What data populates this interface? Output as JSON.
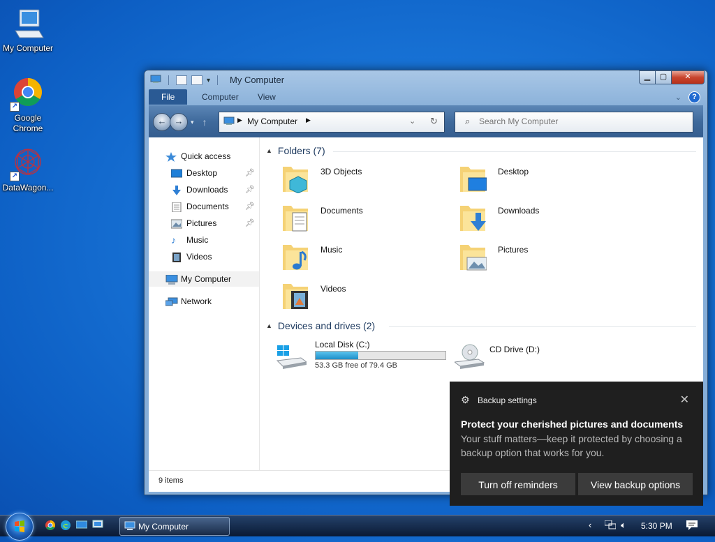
{
  "desktop": {
    "icons": [
      {
        "label": "My Computer"
      },
      {
        "label": "Google\nChrome"
      },
      {
        "label": "DataWagon..."
      }
    ]
  },
  "window": {
    "title": "My Computer",
    "controls": {
      "close": "✕"
    },
    "ribbon": {
      "tabs": [
        "File",
        "Computer",
        "View"
      ],
      "help": "?"
    },
    "address": {
      "path": "My Computer"
    },
    "search": {
      "placeholder": "Search My Computer"
    },
    "nav": [
      {
        "label": "Quick access",
        "icon": "star-icon"
      },
      {
        "label": "Desktop",
        "icon": "desktop-icon",
        "pinned": true
      },
      {
        "label": "Downloads",
        "icon": "download-icon",
        "pinned": true
      },
      {
        "label": "Documents",
        "icon": "document-icon",
        "pinned": true
      },
      {
        "label": "Pictures",
        "icon": "picture-icon",
        "pinned": true
      },
      {
        "label": "Music",
        "icon": "music-icon"
      },
      {
        "label": "Videos",
        "icon": "video-icon"
      },
      {
        "label": "My Computer",
        "icon": "computer-icon"
      },
      {
        "label": "Network",
        "icon": "network-icon"
      }
    ],
    "folders": {
      "header": "Folders (7)",
      "items": [
        "3D Objects",
        "Desktop",
        "Documents",
        "Downloads",
        "Music",
        "Pictures",
        "Videos"
      ]
    },
    "drives": {
      "header": "Devices and drives (2)",
      "items": [
        {
          "name": "Local Disk (C:)",
          "free": "53.3 GB free of 79.4 GB",
          "used_fraction": 0.33
        },
        {
          "name": "CD Drive (D:)"
        }
      ]
    },
    "status": {
      "count": "9 items"
    }
  },
  "toast": {
    "app": "Backup settings",
    "headline": "Protect your cherished pictures and documents",
    "body": "Your stuff matters—keep it protected by choosing a backup option that works for you.",
    "buttons": [
      "Turn off reminders",
      "View backup options"
    ]
  },
  "taskbar": {
    "window_button": "My Computer",
    "clock": "5:30 PM"
  },
  "colors": {
    "accent": "#2a5a94",
    "toast_bg": "#1f1f1f",
    "drive_bar": "#26a0da"
  }
}
